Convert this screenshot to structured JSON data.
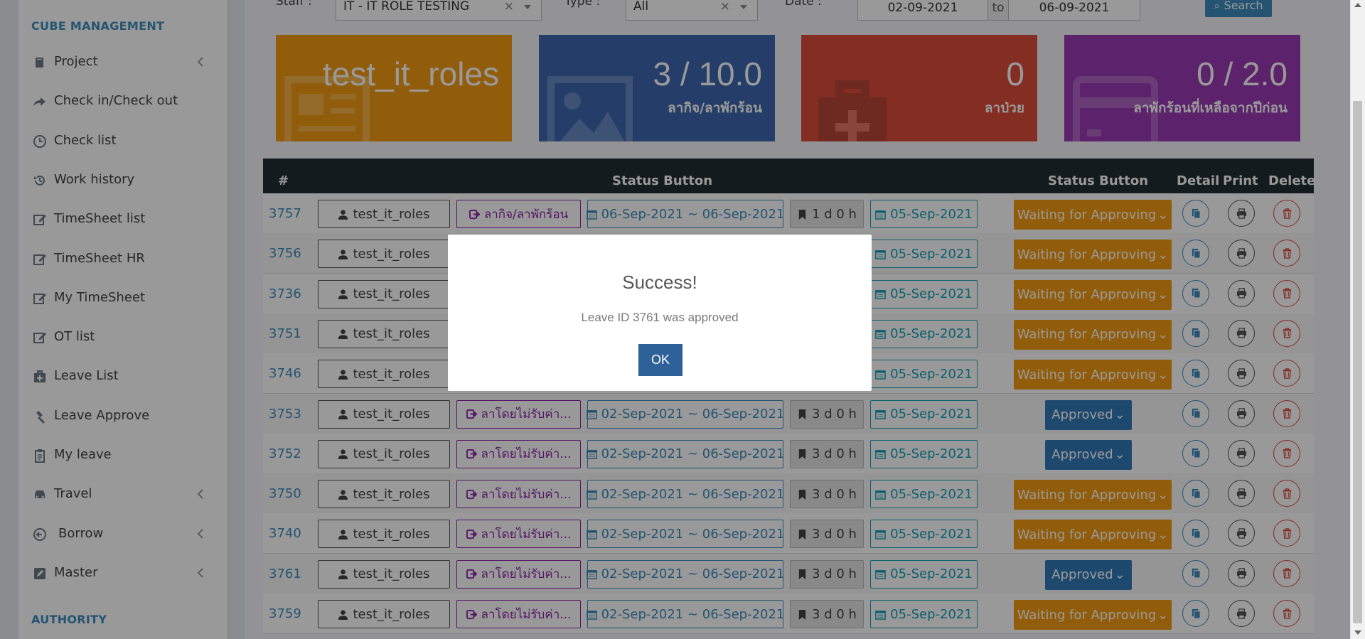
{
  "sidebar": {
    "section_cube": "CUBE MANAGEMENT",
    "section_authority": "AUTHORITY",
    "items": [
      {
        "label": "Project",
        "icon": "book-icon",
        "has_submenu": true
      },
      {
        "label": "Check in/Check out",
        "icon": "share-arrow-icon",
        "has_submenu": false
      },
      {
        "label": "Check list",
        "icon": "clock-icon",
        "has_submenu": false
      },
      {
        "label": "Work history",
        "icon": "history-icon",
        "has_submenu": false
      },
      {
        "label": "TimeSheet list",
        "icon": "edit-icon",
        "has_submenu": false
      },
      {
        "label": "TimeSheet HR",
        "icon": "edit-icon",
        "has_submenu": false
      },
      {
        "label": "My TimeSheet",
        "icon": "edit-icon",
        "has_submenu": false
      },
      {
        "label": "OT list",
        "icon": "edit-icon",
        "has_submenu": false
      },
      {
        "label": "Leave List",
        "icon": "medkit-icon",
        "has_submenu": false
      },
      {
        "label": "Leave Approve",
        "icon": "gavel-icon",
        "has_submenu": false
      },
      {
        "label": "My leave",
        "icon": "clipboard-icon",
        "has_submenu": false
      },
      {
        "label": "Travel",
        "icon": "car-icon",
        "has_submenu": true
      },
      {
        "label": "Borrow",
        "icon": "arrow-circle-icon",
        "has_submenu": true
      },
      {
        "label": "Master",
        "icon": "pencil-square-icon",
        "has_submenu": true
      }
    ]
  },
  "filters": {
    "staff_label": "Staff :",
    "staff_value": "IT - IT ROLE TESTING",
    "type_label": "Type :",
    "type_value": "All",
    "date_label": "Date :",
    "date_from": "02-09-2021",
    "date_to_label": "to",
    "date_to": "06-09-2021",
    "search_label": "Search"
  },
  "stats": [
    {
      "value": "test_it_roles",
      "caption": "",
      "color": "#f39c12",
      "icon": "newspaper-icon"
    },
    {
      "value": "3 / 10.0",
      "caption": "ลากิจ/ลาพักร้อน",
      "color": "#3d68b0",
      "icon": "image-icon"
    },
    {
      "value": "0",
      "caption": "ลาป่วย",
      "color": "#dd4b39",
      "icon": "medkit-icon"
    },
    {
      "value": "0 / 2.0",
      "caption": "ลาพักร้อนที่เหลือจากปีก่อน",
      "color": "#9b3ab5",
      "icon": "credit-card-icon"
    }
  ],
  "table": {
    "headers": {
      "num": "#",
      "status1": "Status Button",
      "status2": "Status Button",
      "detail": "Detail",
      "print": "Print",
      "delete": "Delete"
    },
    "rows": [
      {
        "id": "3757",
        "user": "test_it_roles",
        "type": "ลากิจ/ลาพักร้อน",
        "dates": "06-Sep-2021 ~ 06-Sep-2021",
        "duration": "1 d 0 h",
        "requested": "05-Sep-2021",
        "status": "Waiting for Approving"
      },
      {
        "id": "3756",
        "user": "test_it_roles",
        "type": "",
        "dates": "",
        "duration": "",
        "requested": "05-Sep-2021",
        "status": "Waiting for Approving"
      },
      {
        "id": "3736",
        "user": "test_it_roles",
        "type": "",
        "dates": "",
        "duration": "",
        "requested": "05-Sep-2021",
        "status": "Waiting for Approving"
      },
      {
        "id": "3751",
        "user": "test_it_roles",
        "type": "",
        "dates": "",
        "duration": "",
        "requested": "05-Sep-2021",
        "status": "Waiting for Approving"
      },
      {
        "id": "3746",
        "user": "test_it_roles",
        "type": "",
        "dates": "",
        "duration": "",
        "requested": "05-Sep-2021",
        "status": "Waiting for Approving"
      },
      {
        "id": "3753",
        "user": "test_it_roles",
        "type": "ลาโดยไม่รับค่า...",
        "dates": "02-Sep-2021 ~ 06-Sep-2021",
        "duration": "3 d 0 h",
        "requested": "05-Sep-2021",
        "status": "Approved"
      },
      {
        "id": "3752",
        "user": "test_it_roles",
        "type": "ลาโดยไม่รับค่า...",
        "dates": "02-Sep-2021 ~ 06-Sep-2021",
        "duration": "3 d 0 h",
        "requested": "05-Sep-2021",
        "status": "Approved"
      },
      {
        "id": "3750",
        "user": "test_it_roles",
        "type": "ลาโดยไม่รับค่า...",
        "dates": "02-Sep-2021 ~ 06-Sep-2021",
        "duration": "3 d 0 h",
        "requested": "05-Sep-2021",
        "status": "Waiting for Approving"
      },
      {
        "id": "3740",
        "user": "test_it_roles",
        "type": "ลาโดยไม่รับค่า...",
        "dates": "02-Sep-2021 ~ 06-Sep-2021",
        "duration": "3 d 0 h",
        "requested": "05-Sep-2021",
        "status": "Waiting for Approving"
      },
      {
        "id": "3761",
        "user": "test_it_roles",
        "type": "ลาโดยไม่รับค่า...",
        "dates": "02-Sep-2021 ~ 06-Sep-2021",
        "duration": "3 d 0 h",
        "requested": "05-Sep-2021",
        "status": "Approved"
      },
      {
        "id": "3759",
        "user": "test_it_roles",
        "type": "ลาโดยไม่รับค่า...",
        "dates": "02-Sep-2021 ~ 06-Sep-2021",
        "duration": "3 d 0 h",
        "requested": "05-Sep-2021",
        "status": "Waiting for Approving"
      }
    ]
  },
  "modal": {
    "title": "Success!",
    "message": "Leave ID 3761 was approved",
    "ok_label": "OK"
  },
  "colors": {
    "waiting": "#f39c12",
    "approved": "#337ab7",
    "accent": "#3c8dbc",
    "table_header": "#222d32"
  }
}
